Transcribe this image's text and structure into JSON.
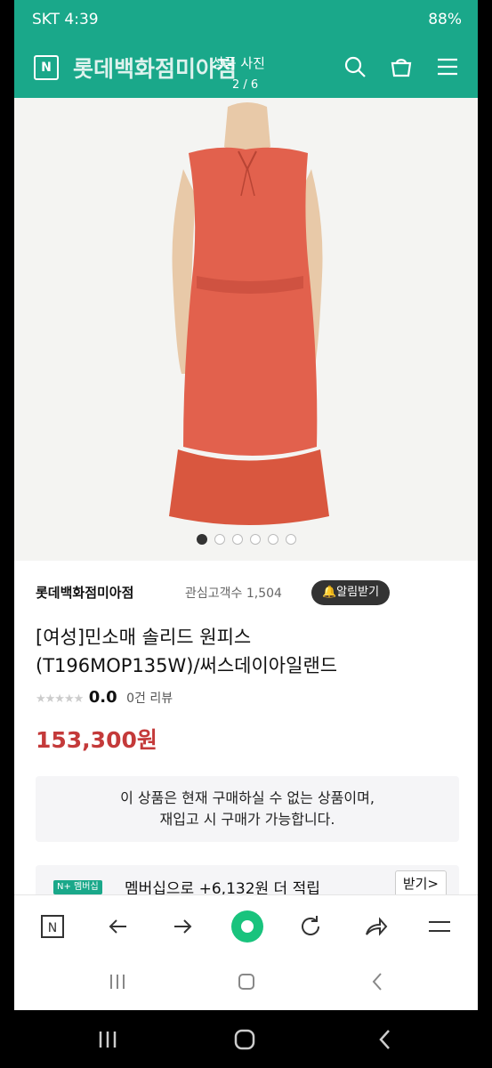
{
  "status": {
    "carrier": "SKT 4:39",
    "battery": "88%"
  },
  "header": {
    "store_title": "롯데백화점미아점",
    "photo_title": "상품 사진",
    "photo_count": "2 / 6"
  },
  "icons": {
    "back": "back-arrow-icon",
    "logo": "naver-n-icon",
    "search": "search-icon",
    "cart": "cart-icon",
    "menu": "menu-icon"
  },
  "store": {
    "name": "롯데백화점미아점",
    "favorites": "관심고객수 1,504",
    "alarm_label": "🔔알림받기"
  },
  "product": {
    "name_line1": "[여성]민소매 솔리드 원피스",
    "name_line2": "(T196MOP135W)/써스데이아일랜드",
    "stars": "★★★★★",
    "rating": "0.0",
    "reviews": "0건 리뷰",
    "price": "153,300원"
  },
  "notice": {
    "line1": "이 상품은 현재 구매하실 수 없는 상품이며,",
    "line2": "재입고 시 구매가 가능합니다."
  },
  "membership": {
    "badge": "N+ 멤버십",
    "text": "멤버십으로 +6,132원 더 적립",
    "button": "받기>"
  },
  "carousel": {
    "total": 6,
    "active": 0
  },
  "colors": {
    "brand": "#1aa88a",
    "price": "#c43a3a",
    "dress": "#e2614d"
  }
}
